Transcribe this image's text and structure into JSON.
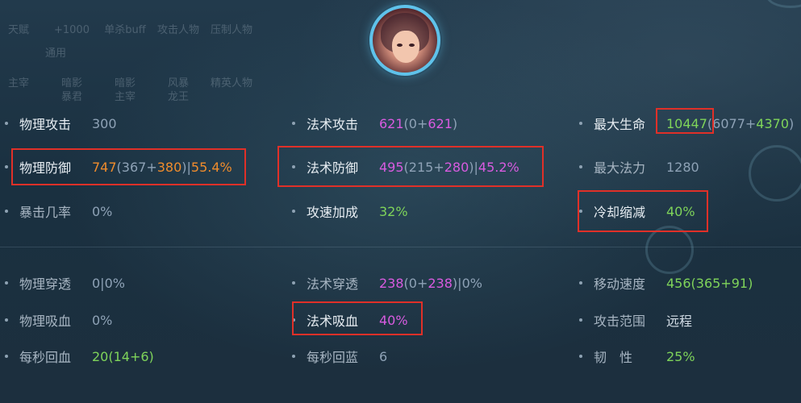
{
  "top_bar": {
    "row1": [
      "天赋",
      "+1000",
      "单杀buff",
      "攻击人物",
      "压制人物"
    ],
    "row2": [
      "通用"
    ],
    "row3": [
      "主宰",
      "暗影\n暴君",
      "暗影\n主宰",
      "风暴\n龙王",
      "精英人物"
    ]
  },
  "stats": {
    "physical_attack": {
      "label": "物理攻击",
      "value": "300"
    },
    "magic_attack": {
      "label": "法术攻击",
      "total": "621",
      "detail_open": "(0+",
      "bonus": "621",
      "detail_close": ")"
    },
    "max_hp": {
      "label": "最大生命",
      "total": "10447",
      "detail_open": "(6077+",
      "bonus": "4370",
      "detail_close": ")"
    },
    "physical_defense": {
      "label": "物理防御",
      "total": "747",
      "detail_open": "(367+",
      "bonus": "380",
      "detail_close": ")|",
      "percent": "55.4%"
    },
    "magic_defense": {
      "label": "法术防御",
      "total": "495",
      "detail_open": "(215+",
      "bonus": "280",
      "detail_close": ")|",
      "percent": "45.2%"
    },
    "max_mana": {
      "label": "最大法力",
      "value": "1280"
    },
    "crit_rate": {
      "label": "暴击几率",
      "value": "0%"
    },
    "attack_speed": {
      "label": "攻速加成",
      "value": "32%"
    },
    "cooldown": {
      "label": "冷却缩减",
      "value": "40%"
    },
    "physical_pen": {
      "label": "物理穿透",
      "value": "0|0%"
    },
    "magic_pen": {
      "label": "法术穿透",
      "total": "238",
      "detail_open": "(0+",
      "bonus": "238",
      "detail_close": ")|",
      "percent": "0%"
    },
    "move_speed": {
      "label": "移动速度",
      "total": "456",
      "detail": "(365+91)"
    },
    "physical_lifesteal": {
      "label": "物理吸血",
      "value": "0%"
    },
    "magic_lifesteal": {
      "label": "法术吸血",
      "value": "40%"
    },
    "attack_range": {
      "label": "攻击范围",
      "value": "远程"
    },
    "hp_regen": {
      "label": "每秒回血",
      "total": "20",
      "detail": "(14+6)"
    },
    "mana_regen": {
      "label": "每秒回蓝",
      "value": "6"
    },
    "tenacity": {
      "label": "韧　性",
      "value": "25%"
    }
  },
  "colors": {
    "highlight_box": "#e03028",
    "orange": "#f08c2c",
    "magenta": "#d85be0",
    "green": "#7fd45a",
    "avatar_ring": "#5fc2ea"
  },
  "icons": {
    "avatar": "hero-portrait"
  }
}
